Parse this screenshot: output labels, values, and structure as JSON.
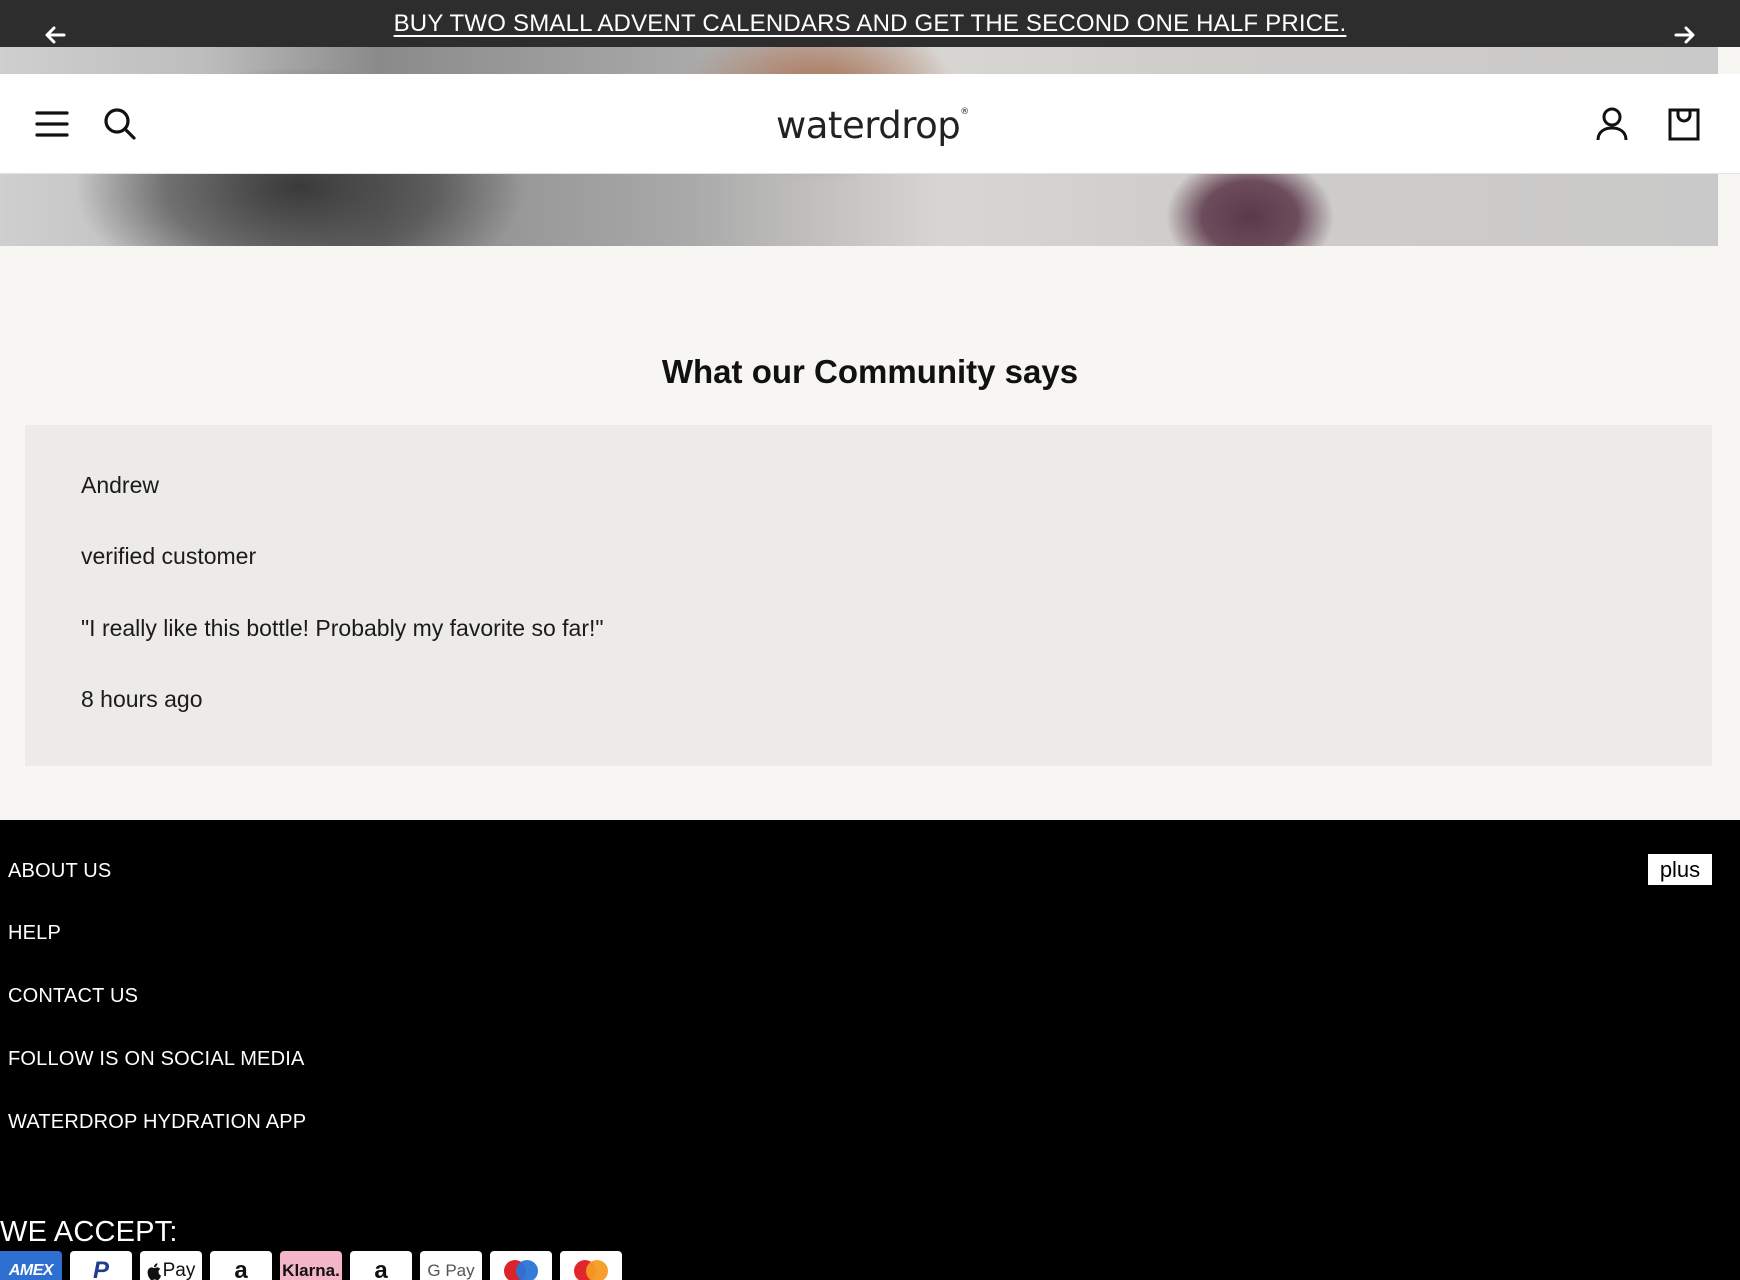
{
  "announcement": {
    "text": "BUY TWO SMALL ADVENT CALENDARS AND GET THE SECOND ONE HALF PRICE."
  },
  "header": {
    "logo_text": "waterdrop",
    "logo_mark": "®"
  },
  "community": {
    "title": "What our Community says",
    "review": {
      "author": "Andrew",
      "badge": "verified customer",
      "quote": "\"I really like this bottle! Probably my favorite so far!\"",
      "time": "8 hours ago"
    }
  },
  "footer": {
    "links": [
      "ABOUT US",
      "HELP",
      "CONTACT US",
      "FOLLOW IS ON SOCIAL MEDIA",
      "WATERDROP HYDRATION APP"
    ],
    "plus_label": "plus",
    "accept_title": "WE ACCEPT:",
    "payments": [
      {
        "name": "amex-icon",
        "label": "AMEX"
      },
      {
        "name": "paypal-icon",
        "label": "P"
      },
      {
        "name": "apple-pay-icon",
        "label": "Pay"
      },
      {
        "name": "amazon-pay-icon",
        "label": "a"
      },
      {
        "name": "klarna-icon",
        "label": "Klarna."
      },
      {
        "name": "amazon-icon",
        "label": "a"
      },
      {
        "name": "google-pay-icon",
        "label": "G Pay"
      },
      {
        "name": "maestro-icon",
        "label": ""
      },
      {
        "name": "mastercard-icon",
        "label": ""
      }
    ]
  },
  "colors": {
    "announcement_bg": "#2d2d2d",
    "page_bg": "#f7f6f2",
    "card_bg": "#ecebe7",
    "footer_bg": "#000000"
  }
}
